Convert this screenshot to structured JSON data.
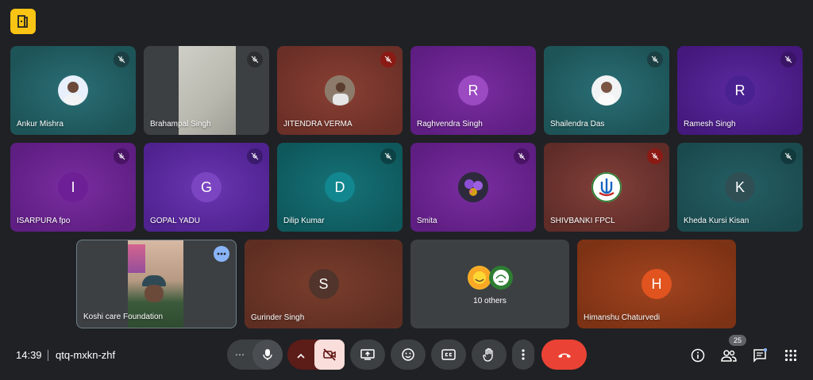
{
  "app": {
    "logo_icon": "classroom-door-icon"
  },
  "participants_row1": [
    {
      "name": "Ankur Mishra",
      "color": "teal",
      "avatar": "photo"
    },
    {
      "name": "Brahampal Singh",
      "color": "grey",
      "avatar": "video"
    },
    {
      "name": "JITENDRA VERMA",
      "color": "brown",
      "avatar": "photo"
    },
    {
      "name": "Raghvendra Singh",
      "color": "purple",
      "initial": "R"
    },
    {
      "name": "Shailendra Das",
      "color": "teal",
      "avatar": "photo"
    },
    {
      "name": "Ramesh Singh",
      "color": "purple",
      "initial": "R"
    }
  ],
  "participants_row2": [
    {
      "name": "ISARPURA fpo",
      "color": "purple",
      "initial": "I"
    },
    {
      "name": "GOPAL YADU",
      "color": "purple",
      "initial": "G"
    },
    {
      "name": "Dilip Kumar",
      "color": "teal",
      "initial": "D"
    },
    {
      "name": "Smita",
      "color": "purple",
      "avatar": "photo"
    },
    {
      "name": "SHIVBANKI FPCL",
      "color": "deepred",
      "avatar": "logo"
    },
    {
      "name": "Kheda Kursi Kisan",
      "color": "dteal",
      "initial": "K"
    }
  ],
  "participants_row3": [
    {
      "name": "Koshi care Foundation",
      "color": "grey",
      "avatar": "video"
    },
    {
      "name": "Gurinder Singh",
      "color": "brown",
      "initial": "S"
    },
    {
      "name": "10 others",
      "color": "grey"
    },
    {
      "name": "Himanshu Chaturvedi",
      "color": "orange",
      "initial": "H"
    }
  ],
  "meeting": {
    "time": "14:39",
    "code": "qtq-mxkn-zhf"
  },
  "people_count": "25",
  "colors": {
    "accent_red": "#ea4335",
    "hangup": "#ea4335",
    "cam_off_bg": "#f9dedc"
  }
}
